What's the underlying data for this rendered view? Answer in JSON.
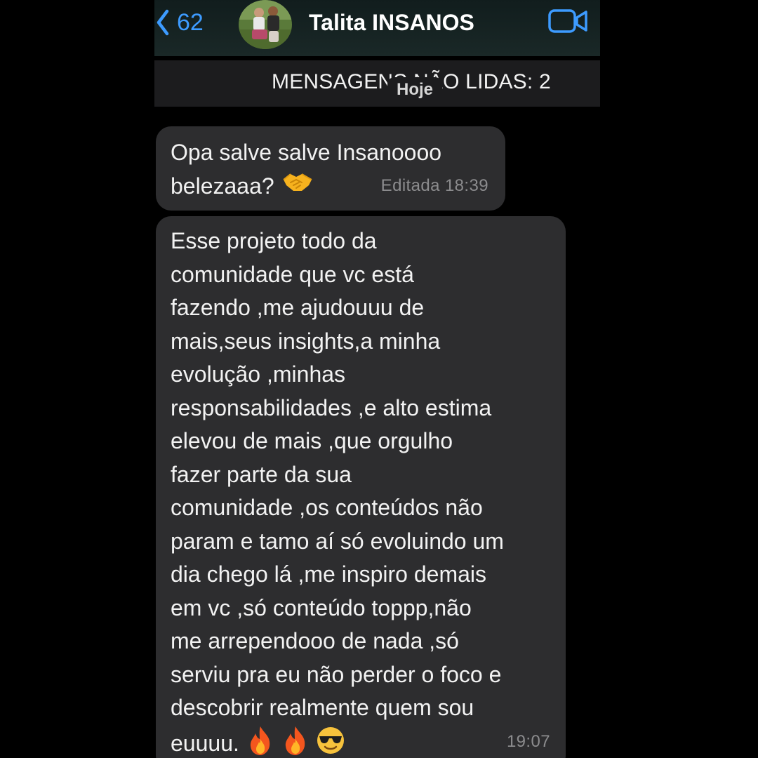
{
  "header": {
    "back_count": "62",
    "contact_name": "Talita INSANOS",
    "accent_color": "#3d9bff"
  },
  "unread_banner": {
    "text": "MENSAGENS NÃO LIDAS: 2",
    "day_label": "Hoje"
  },
  "messages": [
    {
      "text": "Opa salve salve Insanoooo\nbelezaaa? ",
      "emojis": [
        "handshake-emoji"
      ],
      "meta": "Editada 18:39"
    },
    {
      "text": "Esse projeto todo da\ncomunidade que vc está\nfazendo ,me ajudouuu de\nmais,seus insights,a  minha\nevolução ,minhas\nresponsabilidades ,e alto estima\nelevou de mais ,que orgulho\nfazer parte  da sua\ncomunidade ,os conteúdos não\nparam e tamo aí só evoluindo um\ndia chego lá ,me inspiro demais\nem vc ,só conteúdo toppp,não\nme arrependooo de nada ,só\nserviu pra eu não perder o foco e\ndescobrir realmente quem sou\neuuuu. ",
      "emojis": [
        "fire-emoji",
        "fire-emoji",
        "sunglasses-emoji"
      ],
      "meta": "19:07"
    }
  ]
}
